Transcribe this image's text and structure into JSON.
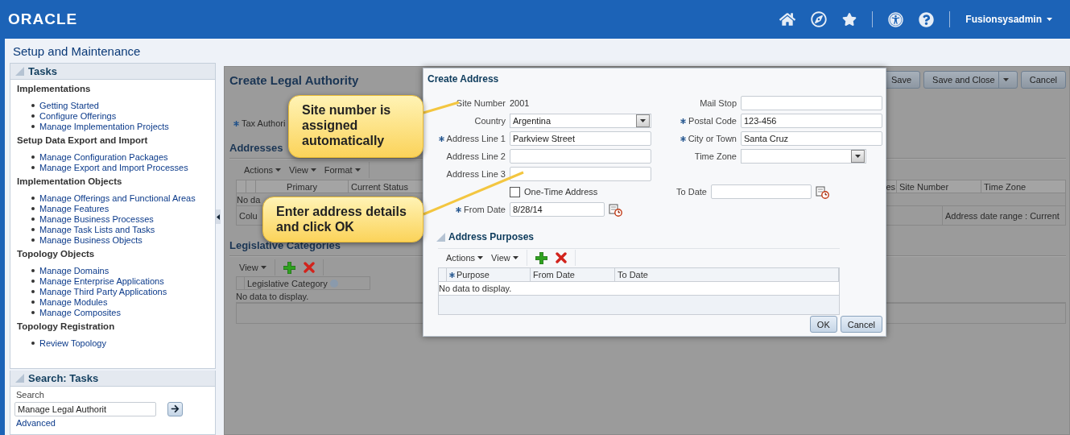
{
  "header": {
    "logo": "ORACLE",
    "user": "Fusionsysadmin"
  },
  "page_title": "Setup and Maintenance",
  "tasks_panel": {
    "title": "Tasks",
    "expanded": true,
    "groups": [
      {
        "heading": "Implementations",
        "items": [
          "Getting Started",
          "Configure Offerings",
          "Manage Implementation Projects"
        ]
      },
      {
        "heading": "Setup Data Export and Import",
        "items": [
          "Manage Configuration Packages",
          "Manage Export and Import Processes"
        ]
      },
      {
        "heading": "Implementation Objects",
        "items": [
          "Manage Offerings and Functional Areas",
          "Manage Features",
          "Manage Business Processes",
          "Manage Task Lists and Tasks",
          "Manage Business Objects"
        ]
      },
      {
        "heading": "Topology Objects",
        "items": [
          "Manage Domains",
          "Manage Enterprise Applications",
          "Manage Third Party Applications",
          "Manage Modules",
          "Manage Composites"
        ]
      },
      {
        "heading": "Topology Registration",
        "items": [
          "Review Topology"
        ]
      }
    ]
  },
  "search_panel": {
    "title": "Search: Tasks",
    "expanded": true,
    "label": "Search",
    "value": "Manage Legal Authorit",
    "link": "Advanced"
  },
  "main": {
    "title": "Create Legal Authority",
    "buttons": [
      "Save",
      "Save and Close",
      "Cancel"
    ],
    "tax_field": {
      "label": "Tax Authori",
      "required": true
    },
    "addresses": {
      "title": "Addresses",
      "toolbar": [
        "Actions",
        "View",
        "Format"
      ],
      "columns_left": [
        "Primary",
        "Current Status"
      ],
      "columns_right": [
        "es",
        "Site Number",
        "Time Zone"
      ],
      "row_text": "No da",
      "footer_left": "Colu",
      "footer_right": "Address date range : Current"
    },
    "legislative": {
      "title": "Legislative Categories",
      "toolbar": [
        "View"
      ],
      "column": "Legislative Category",
      "empty": "No data to display."
    }
  },
  "dialog": {
    "title": "Create Address",
    "left_fields": [
      {
        "kind": "text",
        "label": "Site Number",
        "required": false,
        "value": "2001"
      },
      {
        "kind": "select",
        "label": "Country",
        "required": false,
        "value": "Argentina"
      },
      {
        "kind": "input",
        "label": "Address Line 1",
        "required": true,
        "value": "Parkview Street"
      },
      {
        "kind": "input",
        "label": "Address Line 2",
        "required": false
      },
      {
        "kind": "input",
        "label": "Address Line 3",
        "required": false
      },
      {
        "kind": "checkbox",
        "label": "One-Time Address",
        "checked": false
      },
      {
        "kind": "date",
        "label": "From Date",
        "required": true,
        "value": "8/28/14"
      }
    ],
    "right_fields": [
      {
        "kind": "input",
        "label": "Mail Stop",
        "required": false
      },
      {
        "kind": "input",
        "label": "Postal Code",
        "required": true,
        "value": "123-456"
      },
      {
        "kind": "input",
        "label": "City or Town",
        "required": true,
        "value": "Santa Cruz"
      },
      {
        "kind": "select",
        "label": "Time Zone",
        "required": false
      },
      {
        "kind": "blank"
      },
      {
        "kind": "date",
        "label": "To Date",
        "required": false
      }
    ],
    "purposes": {
      "title": "Address Purposes",
      "expanded": true,
      "toolbar": [
        "Actions",
        "View"
      ],
      "columns": [
        {
          "label": "Purpose",
          "required": true
        },
        {
          "label": "From Date",
          "required": false
        },
        {
          "label": "To Date",
          "required": false
        }
      ],
      "empty": "No data to display."
    },
    "buttons": [
      "OK",
      "Cancel"
    ]
  },
  "callouts": [
    {
      "text": "Site number is assigned automatically"
    },
    {
      "text": "Enter address details and click OK"
    }
  ]
}
